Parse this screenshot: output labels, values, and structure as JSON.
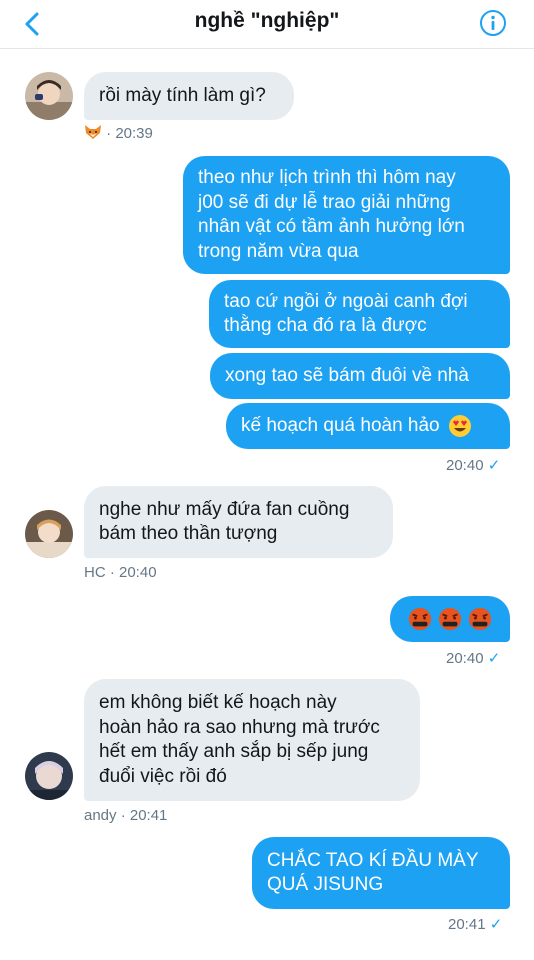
{
  "header": {
    "title": "nghề \"nghiệp\""
  },
  "messages": [
    {
      "id": "m1",
      "text": "rồi mày tính làm gì?"
    },
    {
      "id": "m2",
      "text": "theo như lịch trình thì hôm nay\nj00 sẽ đi dự lễ trao giải những\nnhân vật có tầm ảnh hưởng lớn\ntrong năm vừa qua"
    },
    {
      "id": "m3",
      "text": "tao cứ ngồi ở ngoài canh đợi\nthằng cha đó ra là được"
    },
    {
      "id": "m4",
      "text": "xong tao sẽ bám đuôi về nhà"
    },
    {
      "id": "m5",
      "text": "kế hoạch quá hoàn hảo"
    },
    {
      "id": "m6",
      "text": "nghe như mấy đứa fan cuồng\nbám theo thần tượng"
    },
    {
      "id": "m7",
      "text": ""
    },
    {
      "id": "m8",
      "text": "em không biết kế hoạch này\nhoàn hảo ra sao nhưng mà trước\nhết em thấy anh sắp bị sếp jung\nđuổi việc rồi đó"
    },
    {
      "id": "m9",
      "text": "CHẮC TAO KÍ ĐẦU MÀY\nQUÁ JISUNG"
    }
  ],
  "meta": {
    "m1": "· 20:39",
    "outgoing1": "20:40",
    "m6": "HC · 20:40",
    "outgoing2": "20:40",
    "m8_sender": "andy",
    "m8_time": "· 20:41",
    "outgoing3": "20:41"
  },
  "icons": {
    "back": "chevron-left-icon",
    "info": "info-icon",
    "read": "check-icon",
    "fox": "fox-emoji",
    "heart_eyes": "heart-eyes-emoji",
    "angry": "cursing-face-emoji"
  },
  "colors": {
    "accent": "#1da1f2",
    "incoming": "#e6ecf0",
    "meta": "#657786"
  }
}
